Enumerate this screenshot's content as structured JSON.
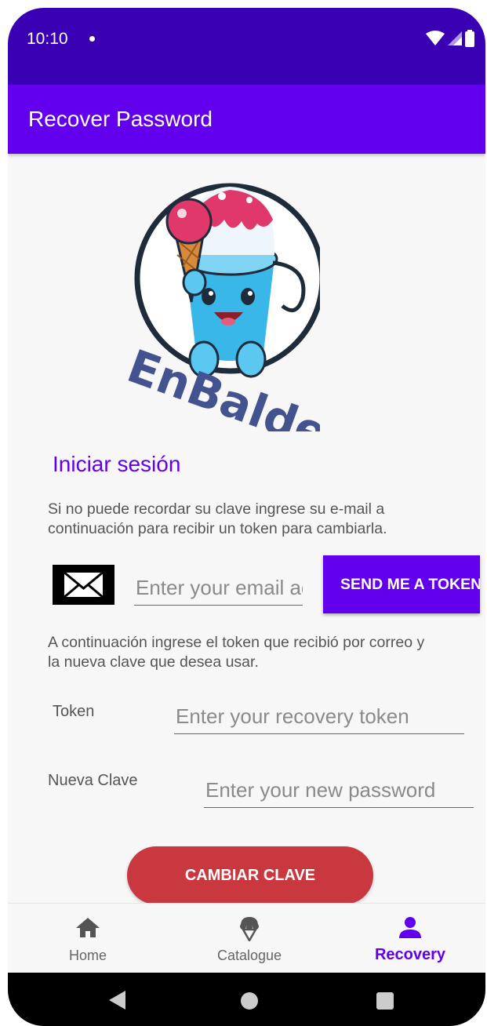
{
  "status_bar": {
    "time": "10:10"
  },
  "app_bar": {
    "title": "Recover Password"
  },
  "logo": {
    "text": "EnBalde"
  },
  "login": {
    "title": "Iniciar sesión",
    "instructions": "Si no puede recordar su clave ingrese su e-mail a continuación para recibir un token para cambiarla.",
    "instructions_line1": "Si no puede recordar su clave ingrese su e-mail a",
    "instructions_line2": "continuación para recibir un token para cambiarla.",
    "email_placeholder": "Enter your email address",
    "send_button": "SEND ME A TOKEN"
  },
  "reset": {
    "instructions_line1": "A continuación ingrese el token que recibió por correo y",
    "instructions_line2": "la nueva clave que desea usar.",
    "token_label": "Token",
    "token_placeholder": "Enter your recovery token",
    "password_label": "Nueva Clave",
    "password_placeholder": "Enter your new password",
    "submit_button": "CAMBIAR CLAVE"
  },
  "bottom_nav": {
    "items": [
      {
        "label": "Home",
        "icon": "home-icon",
        "active": false
      },
      {
        "label": "Catalogue",
        "icon": "ice-cream-icon",
        "active": false
      },
      {
        "label": "Recovery",
        "icon": "person-icon",
        "active": true
      }
    ]
  },
  "colors": {
    "status_bar": "#3a00b4",
    "primary": "#6200ee",
    "submit": "#c9373f"
  }
}
